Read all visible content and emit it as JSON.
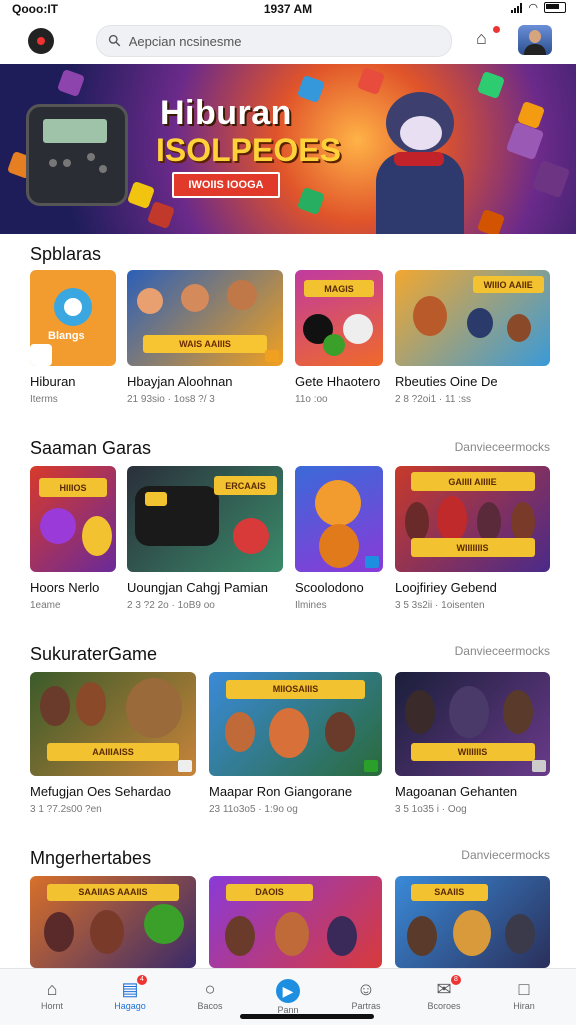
{
  "status_bar": {
    "carrier": "Qooo:IT",
    "time": "1937 AM"
  },
  "header": {
    "search_placeholder": "Aepcian ncsinesme"
  },
  "hero": {
    "title": "Hiburan",
    "subtitle": "ISOLPEOES",
    "cta_label": "IWOIIS IOOGA"
  },
  "sections": [
    {
      "title": "Spblaras",
      "more": "",
      "items": [
        {
          "name": "Hiburan",
          "meta": "Iterms"
        },
        {
          "name": "Hbayjan Aloohnan",
          "meta": "21 93sio · 1os8 ?/ 3"
        },
        {
          "name": "Gete Hhaotero",
          "meta": "11o :oo"
        },
        {
          "name": "Rbeuties Oine De",
          "meta": "2 8 ?2oi1 · 11 :ss"
        }
      ]
    },
    {
      "title": "Saaman Garas",
      "more": "Danvieceermocks",
      "items": [
        {
          "name": "Hoors Nerlo",
          "meta": "1eame"
        },
        {
          "name": "Uoungjan Cahgj Pamian",
          "meta": "2 3 ?2 2o · 1oB9 oo"
        },
        {
          "name": "Scoolodono",
          "meta": "Ilmines"
        },
        {
          "name": "Loojfiriey Gebend",
          "meta": "3 5 3s2ii · 1oisenten"
        }
      ]
    },
    {
      "title": "SukuraterGame",
      "more": "Danvieceermocks",
      "items": [
        {
          "name": "Mefugjan Oes Sehardao",
          "meta": "3 1 ?7.2s00 ?en"
        },
        {
          "name": "Maapar Ron Giangorane",
          "meta": "23 11o3o5 · 1:9o og"
        },
        {
          "name": "Magoanan Gehanten",
          "meta": "3 5 1o35 i · Oog"
        }
      ]
    },
    {
      "title": "Mngerhertabes",
      "more": "Danviecermocks",
      "items": [
        {
          "name": "",
          "meta": ""
        },
        {
          "name": "",
          "meta": ""
        },
        {
          "name": "",
          "meta": ""
        }
      ]
    }
  ],
  "nav": [
    {
      "label": "Hornt",
      "icon": "home-icon"
    },
    {
      "label": "Hagago",
      "icon": "store-icon",
      "badge": "4"
    },
    {
      "label": "Bacos",
      "icon": "search-icon"
    },
    {
      "label": "Pann",
      "icon": "play-icon"
    },
    {
      "label": "Partras",
      "icon": "people-icon"
    },
    {
      "label": "Bcoroes",
      "icon": "mail-icon",
      "badge": "8"
    },
    {
      "label": "Hiran",
      "icon": "document-icon"
    }
  ],
  "colors": {
    "accent": "#1e6fd8",
    "badge": "#e33333"
  }
}
